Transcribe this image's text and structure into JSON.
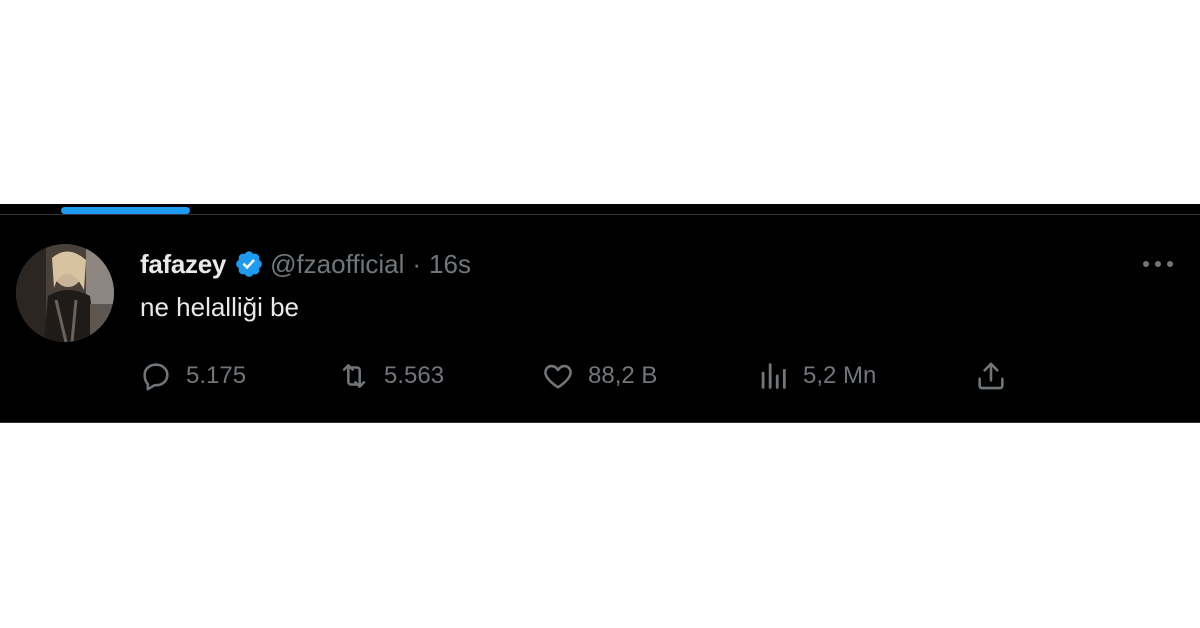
{
  "tweet": {
    "display_name": "fafazey",
    "verified": true,
    "handle": "@fzaofficial",
    "separator": "·",
    "timestamp": "16s",
    "text": "ne helalliği be",
    "more_icon": "more-horizontal-icon",
    "actions": {
      "reply": {
        "icon": "reply-icon",
        "count": "5.175"
      },
      "retweet": {
        "icon": "retweet-icon",
        "count": "5.563"
      },
      "like": {
        "icon": "heart-icon",
        "count": "88,2 B"
      },
      "views": {
        "icon": "views-chart-icon",
        "count": "5,2 Mn"
      },
      "share": {
        "icon": "share-icon"
      }
    }
  },
  "colors": {
    "background": "#000000",
    "primary_text": "#e7e9ea",
    "secondary_text": "#71767b",
    "accent": "#1d9bf0",
    "divider": "#2f3336"
  }
}
